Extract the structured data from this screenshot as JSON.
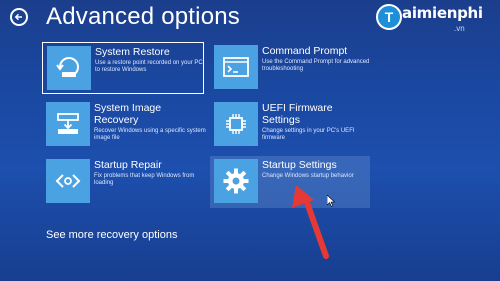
{
  "page": {
    "title": "Advanced options"
  },
  "tiles": [
    {
      "title": "System Restore",
      "desc": "Use a restore point recorded on your PC to restore Windows",
      "icon": "system-restore-icon"
    },
    {
      "title": "Command Prompt",
      "desc": "Use the Command Prompt for advanced troubleshooting",
      "icon": "command-prompt-icon"
    },
    {
      "title": "System Image Recovery",
      "desc": "Recover Windows using a specific system image file",
      "icon": "system-image-icon"
    },
    {
      "title": "UEFI Firmware Settings",
      "desc": "Change settings in your PC's UEFI firmware",
      "icon": "firmware-icon"
    },
    {
      "title": "Startup Repair",
      "desc": "Fix problems that keep Windows from loading",
      "icon": "startup-repair-icon"
    },
    {
      "title": "Startup Settings",
      "desc": "Change Windows startup behavior",
      "icon": "gear-icon"
    }
  ],
  "links": {
    "more": "See more recovery options"
  },
  "watermark": {
    "mark": "T",
    "name": "aimienphi",
    "tld": ".vn"
  },
  "colors": {
    "background": "#1b45a0",
    "tile_icon": "#4aa2e2",
    "annotation_arrow": "#e53935"
  }
}
